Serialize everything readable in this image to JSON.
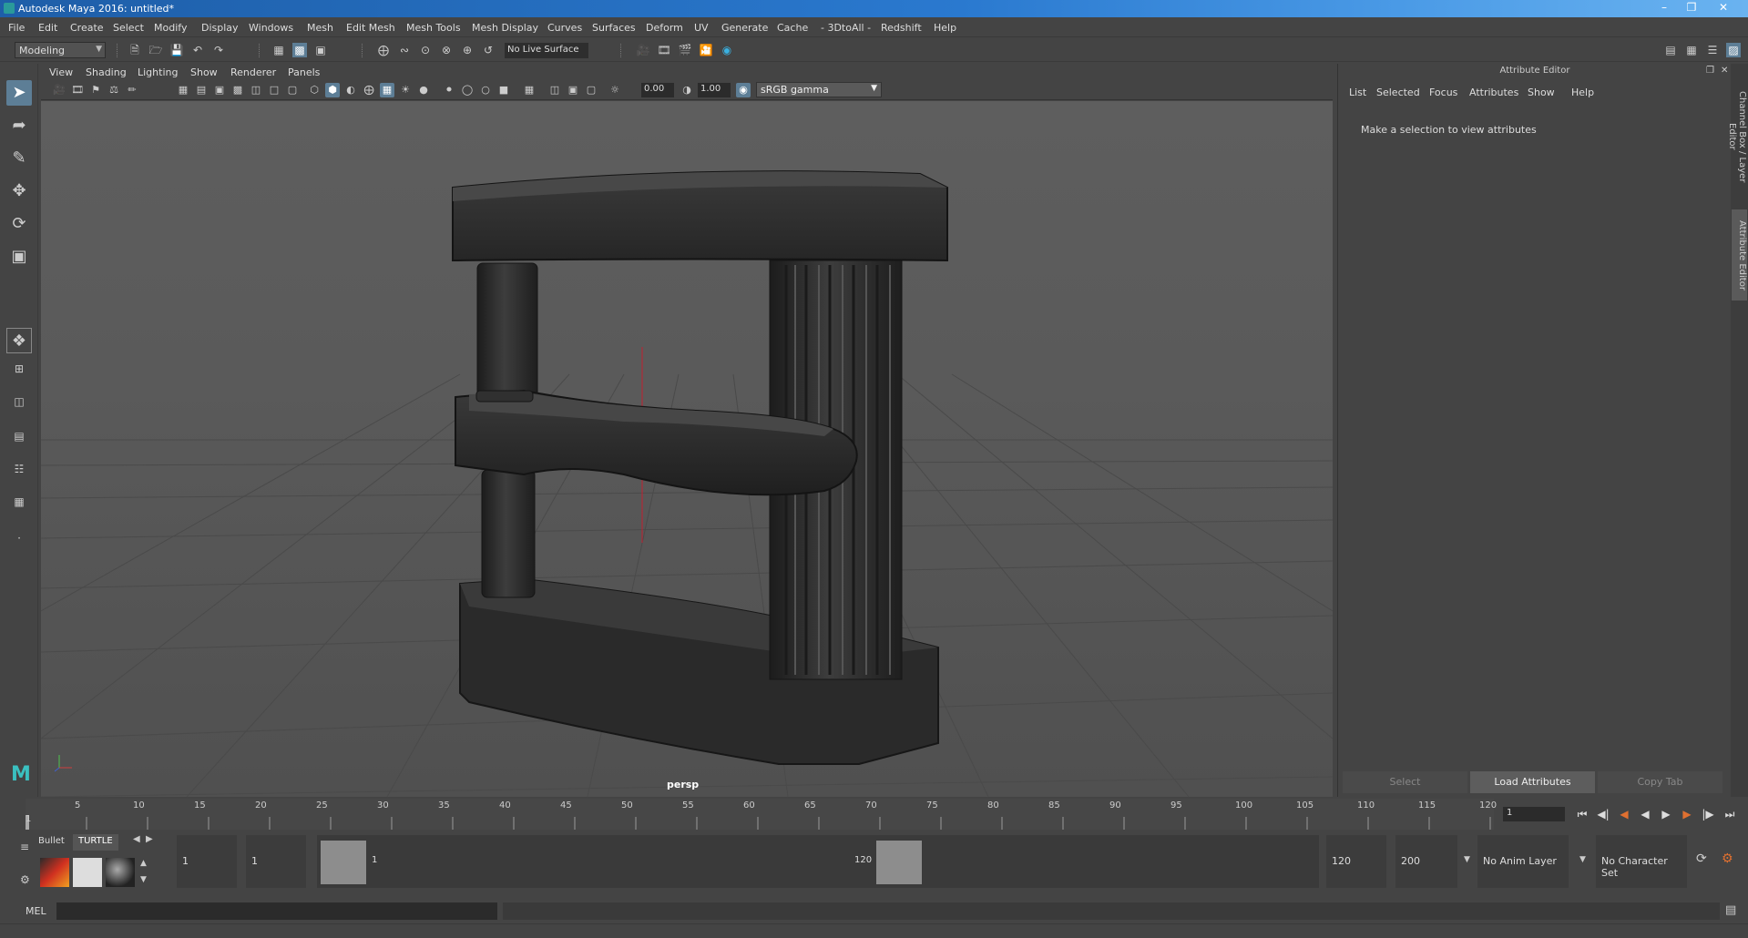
{
  "window": {
    "title": "Autodesk Maya 2016: untitled*"
  },
  "menubar": [
    "File",
    "Edit",
    "Create",
    "Select",
    "Modify",
    "Display",
    "Windows",
    "Mesh",
    "Edit Mesh",
    "Mesh Tools",
    "Mesh Display",
    "Curves",
    "Surfaces",
    "Deform",
    "UV",
    "Generate",
    "Cache",
    "- 3DtoAll -",
    "Redshift",
    "Help"
  ],
  "statusline": {
    "mode": "Modeling",
    "live_surface": "No Live Surface"
  },
  "panel": {
    "menus": [
      "View",
      "Shading",
      "Lighting",
      "Show",
      "Renderer",
      "Panels"
    ],
    "exposure": "0.00",
    "gamma_value": "1.00",
    "color_space": "sRGB gamma",
    "camera_label": "persp"
  },
  "attribute_editor": {
    "title": "Attribute Editor",
    "menus": [
      "List",
      "Selected",
      "Focus",
      "Attributes",
      "Show",
      "Help"
    ],
    "message": "Make a selection to view attributes",
    "buttons": {
      "select": "Select",
      "load": "Load Attributes",
      "copy": "Copy Tab"
    }
  },
  "side_tabs": {
    "channel_box": "Channel Box / Layer Editor",
    "attribute_editor": "Attribute Editor"
  },
  "timeslider": {
    "ticks": [
      "5",
      "10",
      "15",
      "20",
      "25",
      "30",
      "35",
      "40",
      "45",
      "50",
      "55",
      "60",
      "65",
      "70",
      "75",
      "80",
      "85",
      "90",
      "95",
      "100",
      "105",
      "110",
      "115",
      "120"
    ],
    "start_label": "1",
    "current_frame": "1"
  },
  "range": {
    "shelf_tabs": [
      "Bullet",
      "TURTLE"
    ],
    "start_frame": "1",
    "playback_start": "1",
    "range_start_label": "1",
    "range_end_label": "120",
    "playback_end": "120",
    "end_frame": "200",
    "anim_layer": "No Anim Layer",
    "character_set": "No Character Set"
  },
  "cmdline": {
    "language": "MEL"
  },
  "colors": {
    "accent": "#5d7e96",
    "viewport_bg": "#5a5a5a",
    "title_bar": "#2a79cf"
  }
}
